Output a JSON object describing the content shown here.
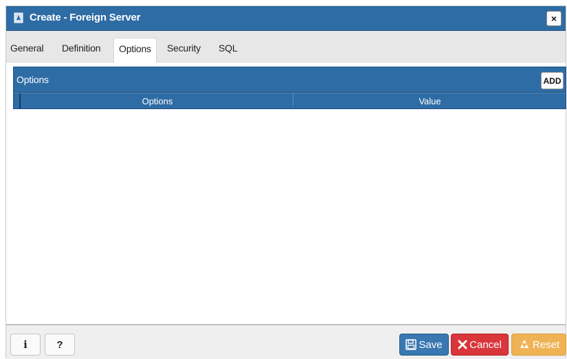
{
  "dialog": {
    "title": "Create - Foreign Server",
    "close_glyph": "×",
    "title_icon": "foreign-server-icon"
  },
  "tabs": [
    {
      "label": "General",
      "active": false
    },
    {
      "label": "Definition",
      "active": false
    },
    {
      "label": "Options",
      "active": true
    },
    {
      "label": "Security",
      "active": false
    },
    {
      "label": "SQL",
      "active": false
    }
  ],
  "options_panel": {
    "title": "Options",
    "add_label": "ADD",
    "columns": [
      "Options",
      "Value"
    ],
    "rows": []
  },
  "footer": {
    "info_glyph": "i",
    "help_glyph": "?",
    "save_label": "Save",
    "cancel_label": "Cancel",
    "reset_label": "Reset"
  },
  "colors": {
    "header_blue": "#2e6ca5",
    "save": "#3a78b1",
    "cancel": "#d9363b",
    "reset": "#efb355"
  }
}
